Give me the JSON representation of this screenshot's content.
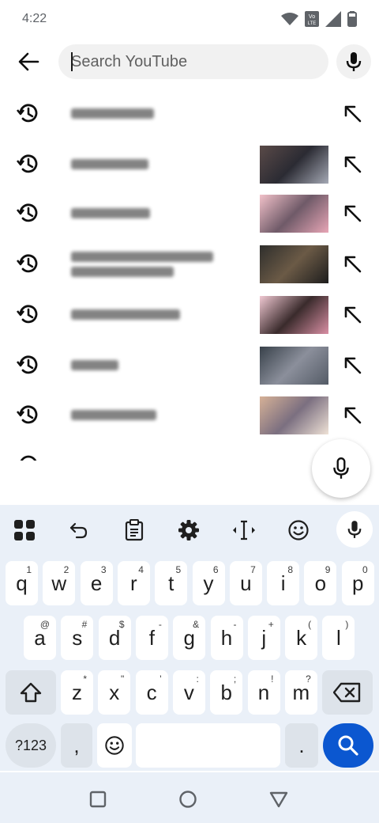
{
  "status": {
    "time": "4:22",
    "icons": [
      "wifi-icon",
      "volte-icon",
      "signal-icon",
      "battery-icon"
    ]
  },
  "search": {
    "placeholder": "Search YouTube",
    "value": ""
  },
  "suggestions": [
    {
      "text": "[redacted]",
      "lines": 1,
      "has_thumb": false
    },
    {
      "text": "[redacted]",
      "lines": 1,
      "has_thumb": true,
      "thumb_colors": [
        "#5a4a48",
        "#2b2b33",
        "#a5a9b5"
      ]
    },
    {
      "text": "[redacted]",
      "lines": 1,
      "has_thumb": true,
      "thumb_colors": [
        "#f2c1c9",
        "#6f5a68",
        "#e8a6b6"
      ]
    },
    {
      "text": "[redacted]",
      "lines": 2,
      "has_thumb": true,
      "thumb_colors": [
        "#2e2e2c",
        "#6b5a46",
        "#1d1d1d"
      ]
    },
    {
      "text": "[redacted]",
      "lines": 1,
      "has_thumb": true,
      "thumb_colors": [
        "#f0c8d2",
        "#3a2b2c",
        "#d98fa4"
      ]
    },
    {
      "text": "[redacted]",
      "lines": 1,
      "has_thumb": true,
      "thumb_colors": [
        "#38414a",
        "#8b8f9b",
        "#545b66"
      ]
    },
    {
      "text": "[redacted]",
      "lines": 1,
      "has_thumb": true,
      "thumb_colors": [
        "#d6b197",
        "#7b6f80",
        "#efe2d6"
      ]
    }
  ],
  "keyboard": {
    "row1": [
      {
        "k": "q",
        "h": "1"
      },
      {
        "k": "w",
        "h": "2"
      },
      {
        "k": "e",
        "h": "3"
      },
      {
        "k": "r",
        "h": "4"
      },
      {
        "k": "t",
        "h": "5"
      },
      {
        "k": "y",
        "h": "6"
      },
      {
        "k": "u",
        "h": "7"
      },
      {
        "k": "i",
        "h": "8"
      },
      {
        "k": "o",
        "h": "9"
      },
      {
        "k": "p",
        "h": "0"
      }
    ],
    "row2": [
      {
        "k": "a",
        "h": "@"
      },
      {
        "k": "s",
        "h": "#"
      },
      {
        "k": "d",
        "h": "$"
      },
      {
        "k": "f",
        "h": "-"
      },
      {
        "k": "g",
        "h": "&"
      },
      {
        "k": "h",
        "h": "-"
      },
      {
        "k": "j",
        "h": "+"
      },
      {
        "k": "k",
        "h": "("
      },
      {
        "k": "l",
        "h": ")"
      }
    ],
    "row3": [
      {
        "k": "z",
        "h": "*"
      },
      {
        "k": "x",
        "h": "\""
      },
      {
        "k": "c",
        "h": "'"
      },
      {
        "k": "v",
        "h": ":"
      },
      {
        "k": "b",
        "h": ";"
      },
      {
        "k": "n",
        "h": "!"
      },
      {
        "k": "m",
        "h": "?"
      }
    ],
    "symbols_label": "?123",
    "comma": ",",
    "period": "."
  },
  "colors": {
    "accent": "#0b57d0",
    "keyboard_bg": "#eaf0f8"
  }
}
